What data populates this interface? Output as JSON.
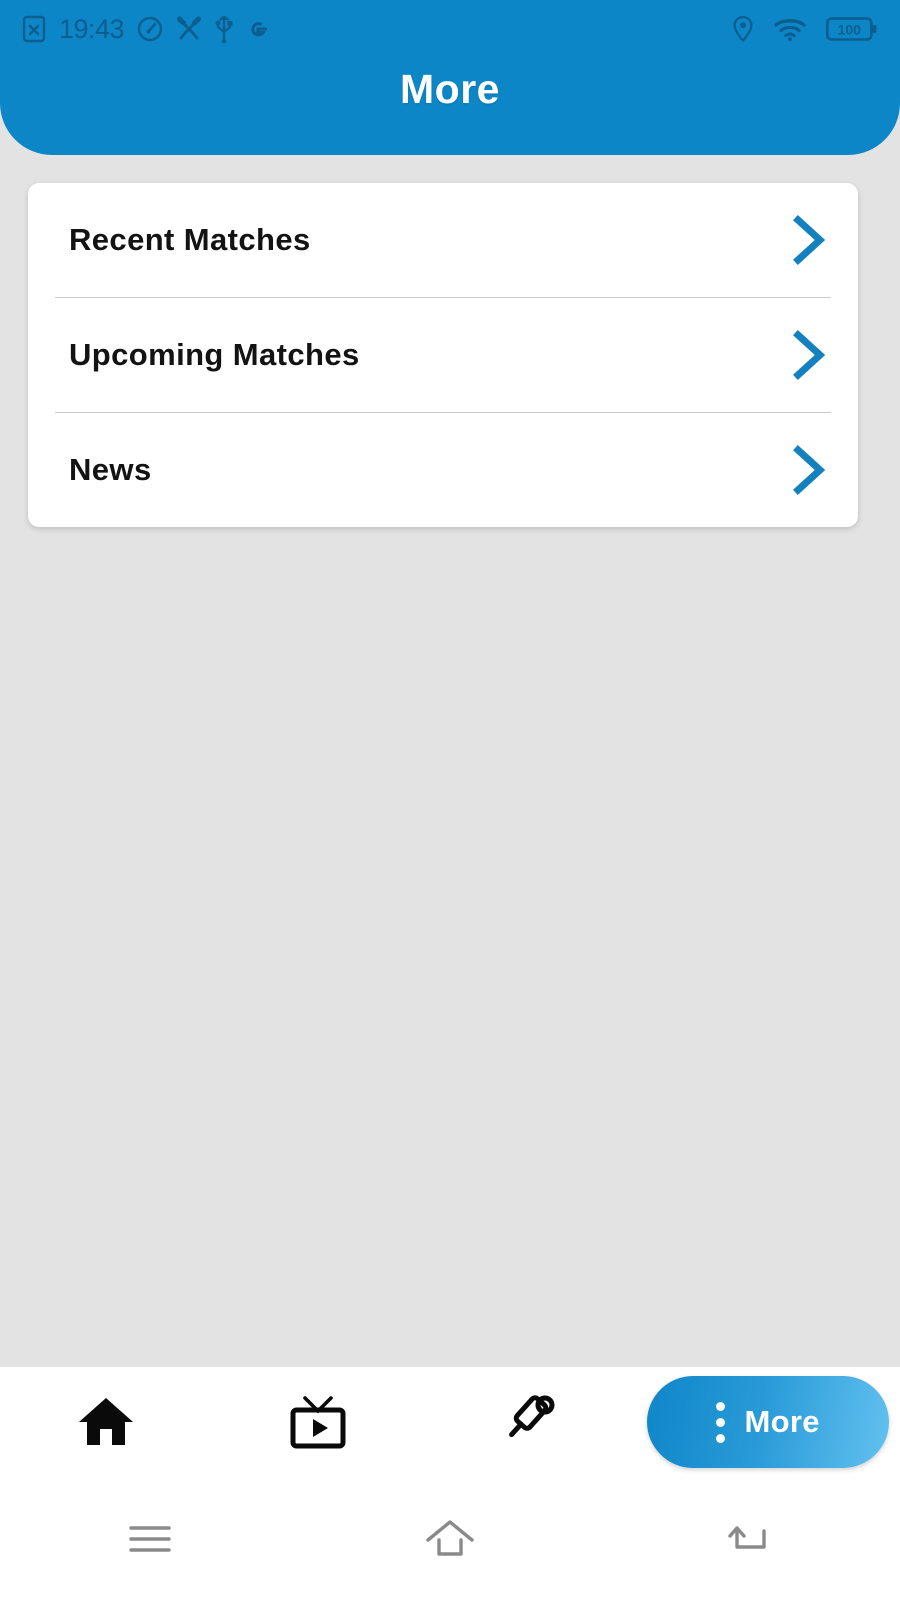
{
  "status_bar": {
    "time": "19:43",
    "left_icons": [
      "sim-card-off-icon",
      "speedometer-icon",
      "tools-icon",
      "usb-icon",
      "google-icon"
    ],
    "right_icons": [
      "location-pin-icon",
      "wifi-icon",
      "battery-icon"
    ],
    "battery_level": "100"
  },
  "header": {
    "title": "More",
    "background_color": "#0d86c8",
    "title_color": "#ffffff"
  },
  "menu": {
    "items": [
      {
        "label": "Recent Matches",
        "chevron": "chevron-right-icon"
      },
      {
        "label": "Upcoming Matches",
        "chevron": "chevron-right-icon"
      },
      {
        "label": "News",
        "chevron": "chevron-right-icon"
      }
    ],
    "chevron_color": "#1380c0",
    "card_background": "#ffffff"
  },
  "bottom_nav": {
    "items": [
      {
        "name": "home",
        "icon": "home-icon"
      },
      {
        "name": "live",
        "icon": "tv-play-icon"
      },
      {
        "name": "matches",
        "icon": "cricket-bat-ball-icon"
      }
    ],
    "more": {
      "label": "More",
      "icon": "dots-vertical-icon",
      "gradient_start": "#0f86c9",
      "gradient_end": "#63c1ef"
    }
  },
  "system_nav": {
    "buttons": [
      {
        "name": "recents",
        "icon": "menu-lines-icon"
      },
      {
        "name": "home",
        "icon": "home-outline-icon"
      },
      {
        "name": "back",
        "icon": "back-arrow-icon"
      }
    ]
  },
  "page": {
    "background_color": "#e3e3e3"
  }
}
